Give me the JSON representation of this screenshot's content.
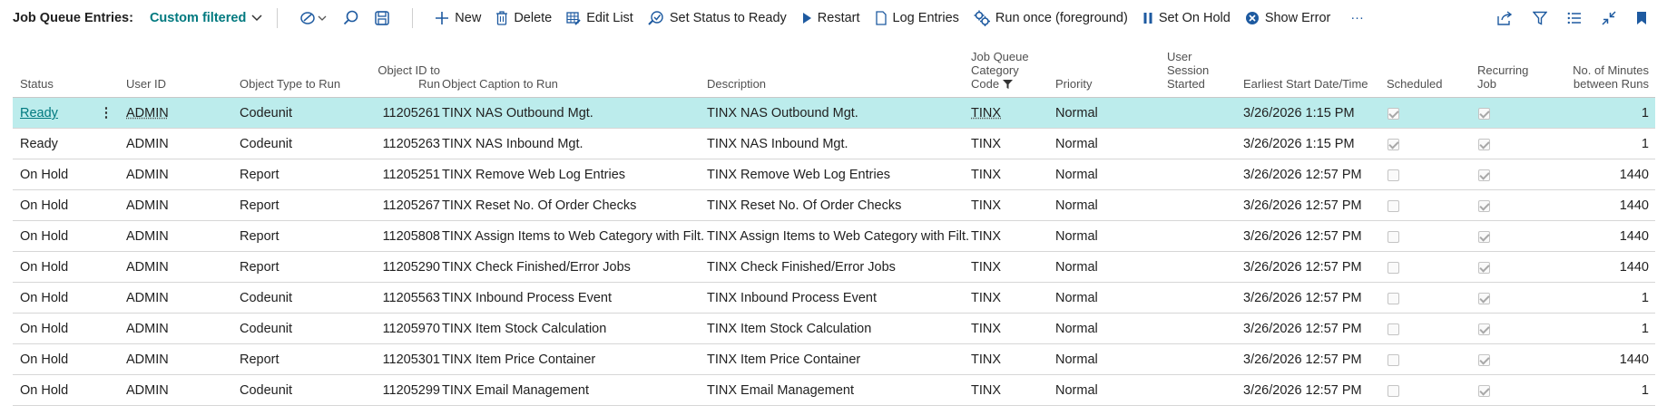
{
  "toolbar": {
    "page_caption": "Job Queue Entries:",
    "view_filter": "Custom filtered",
    "actions": [
      {
        "label": "New"
      },
      {
        "label": "Delete"
      },
      {
        "label": "Edit List"
      },
      {
        "label": "Set Status to Ready"
      },
      {
        "label": "Restart"
      },
      {
        "label": "Log Entries"
      },
      {
        "label": "Run once (foreground)"
      },
      {
        "label": "Set On Hold"
      },
      {
        "label": "Show Error"
      }
    ],
    "more_label": "···"
  },
  "columns": {
    "status": "Status",
    "user_id": "User ID",
    "object_type": "Object Type to Run",
    "object_id_l1": "Object ID to",
    "object_id_l2": "Run",
    "caption": "Object Caption to Run",
    "description": "Description",
    "category_l1": "Job Queue",
    "category_l2": "Category",
    "category_l3": "Code",
    "priority": "Priority",
    "session_l1": "User",
    "session_l2": "Session",
    "session_l3": "Started",
    "earliest_start": "Earliest Start Date/Time",
    "scheduled": "Scheduled",
    "recurring_l1": "Recurring",
    "recurring_l2": "Job",
    "minutes_l1": "No. of Minutes",
    "minutes_l2": "between Runs"
  },
  "rows": [
    {
      "status": "Ready",
      "user_id": "ADMIN",
      "object_type": "Codeunit",
      "object_id": "11205261",
      "caption": "TINX NAS Outbound Mgt.",
      "description": "TINX NAS Outbound Mgt.",
      "category": "TINX",
      "priority": "Normal",
      "earliest_start": "3/26/2026 1:15 PM",
      "scheduled": true,
      "recurring": true,
      "minutes": "1"
    },
    {
      "status": "Ready",
      "user_id": "ADMIN",
      "object_type": "Codeunit",
      "object_id": "11205263",
      "caption": "TINX NAS Inbound Mgt.",
      "description": "TINX NAS Inbound Mgt.",
      "category": "TINX",
      "priority": "Normal",
      "earliest_start": "3/26/2026 1:15 PM",
      "scheduled": true,
      "recurring": true,
      "minutes": "1"
    },
    {
      "status": "On Hold",
      "user_id": "ADMIN",
      "object_type": "Report",
      "object_id": "11205251",
      "caption": "TINX Remove Web Log Entries",
      "description": "TINX Remove Web Log Entries",
      "category": "TINX",
      "priority": "Normal",
      "earliest_start": "3/26/2026 12:57 PM",
      "scheduled": false,
      "recurring": true,
      "minutes": "1440"
    },
    {
      "status": "On Hold",
      "user_id": "ADMIN",
      "object_type": "Report",
      "object_id": "11205267",
      "caption": "TINX Reset No. Of Order Checks",
      "description": "TINX Reset No. Of Order Checks",
      "category": "TINX",
      "priority": "Normal",
      "earliest_start": "3/26/2026 12:57 PM",
      "scheduled": false,
      "recurring": true,
      "minutes": "1440"
    },
    {
      "status": "On Hold",
      "user_id": "ADMIN",
      "object_type": "Report",
      "object_id": "11205808",
      "caption": "TINX Assign Items to Web Category with Filt...",
      "description": "TINX Assign Items to Web Category with Filt...",
      "category": "TINX",
      "priority": "Normal",
      "earliest_start": "3/26/2026 12:57 PM",
      "scheduled": false,
      "recurring": true,
      "minutes": "1440"
    },
    {
      "status": "On Hold",
      "user_id": "ADMIN",
      "object_type": "Report",
      "object_id": "11205290",
      "caption": "TINX Check Finished/Error Jobs",
      "description": "TINX Check Finished/Error Jobs",
      "category": "TINX",
      "priority": "Normal",
      "earliest_start": "3/26/2026 12:57 PM",
      "scheduled": false,
      "recurring": true,
      "minutes": "1440"
    },
    {
      "status": "On Hold",
      "user_id": "ADMIN",
      "object_type": "Codeunit",
      "object_id": "11205563",
      "caption": "TINX Inbound Process Event",
      "description": "TINX Inbound Process Event",
      "category": "TINX",
      "priority": "Normal",
      "earliest_start": "3/26/2026 12:57 PM",
      "scheduled": false,
      "recurring": true,
      "minutes": "1"
    },
    {
      "status": "On Hold",
      "user_id": "ADMIN",
      "object_type": "Codeunit",
      "object_id": "11205970",
      "caption": "TINX Item Stock Calculation",
      "description": "TINX Item Stock Calculation",
      "category": "TINX",
      "priority": "Normal",
      "earliest_start": "3/26/2026 12:57 PM",
      "scheduled": false,
      "recurring": true,
      "minutes": "1"
    },
    {
      "status": "On Hold",
      "user_id": "ADMIN",
      "object_type": "Report",
      "object_id": "11205301",
      "caption": "TINX Item Price Container",
      "description": "TINX Item Price Container",
      "category": "TINX",
      "priority": "Normal",
      "earliest_start": "3/26/2026 12:57 PM",
      "scheduled": false,
      "recurring": true,
      "minutes": "1440"
    },
    {
      "status": "On Hold",
      "user_id": "ADMIN",
      "object_type": "Codeunit",
      "object_id": "11205299",
      "caption": "TINX Email Management",
      "description": "TINX Email Management",
      "category": "TINX",
      "priority": "Normal",
      "earliest_start": "3/26/2026 12:57 PM",
      "scheduled": false,
      "recurring": true,
      "minutes": "1"
    }
  ],
  "colors": {
    "accent": "#00797f",
    "selected_row": "#bcecec"
  }
}
